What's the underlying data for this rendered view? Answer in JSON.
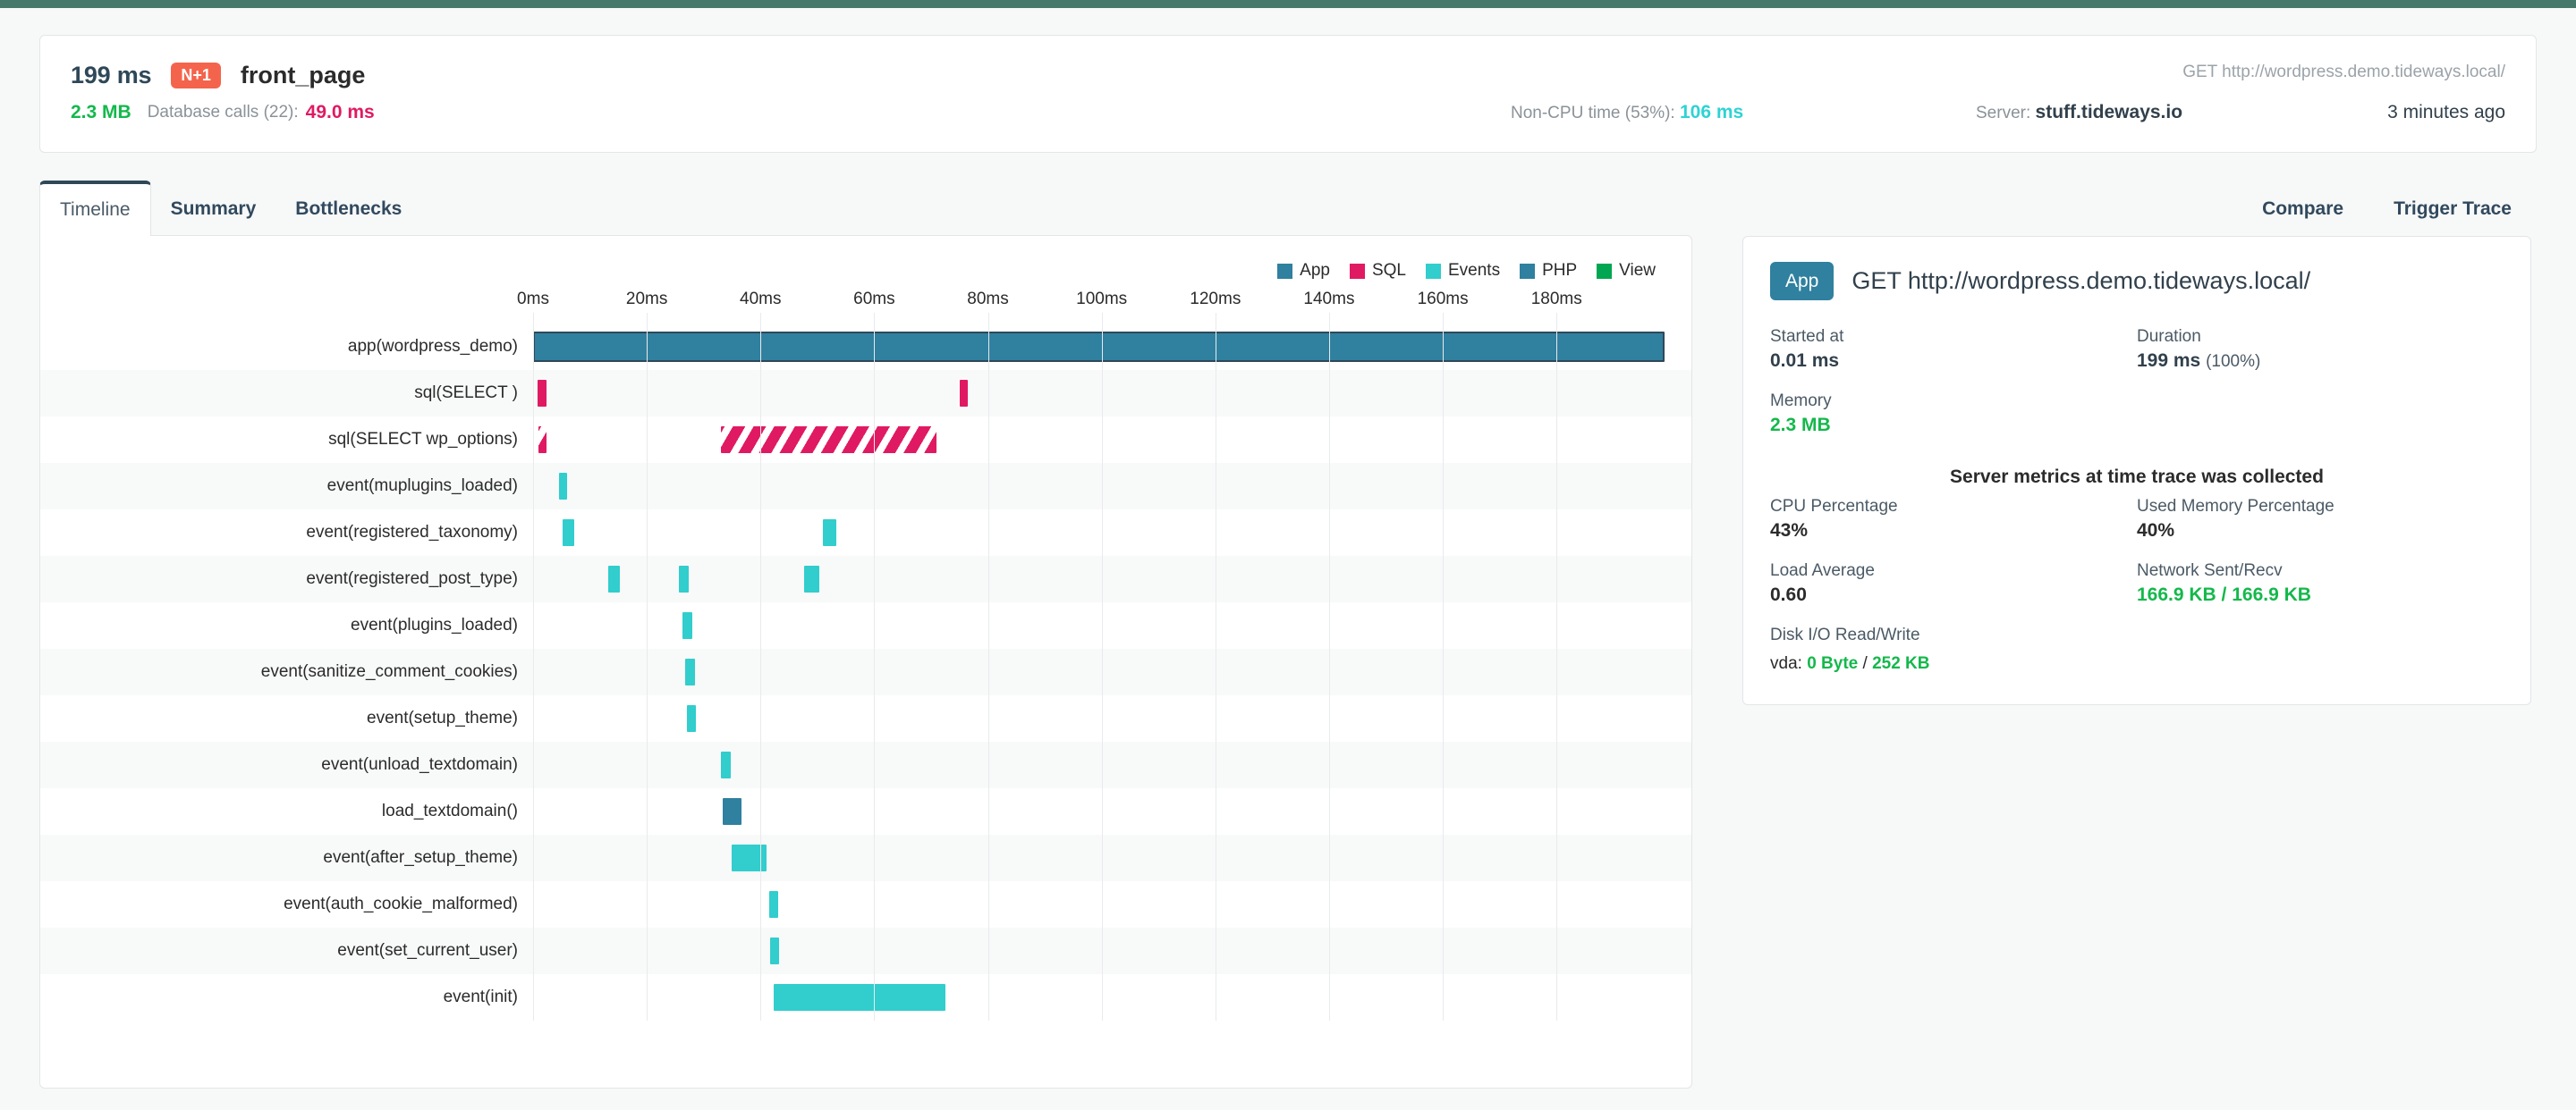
{
  "theme": {
    "topbar_color": "#46796b",
    "accent_blue": "#30809f",
    "accent_pink": "#e01a62",
    "accent_cyan": "#32cdcd",
    "accent_green": "#14b84b",
    "badge_color": "#f4644c"
  },
  "header": {
    "duration": "199 ms",
    "badge": "N+1",
    "transaction": "front_page",
    "url": "GET http://wordpress.demo.tideways.local/",
    "memory": "2.3 MB",
    "db_label": "Database calls (22):",
    "db_time": "49.0 ms",
    "noncpu_label": "Non-CPU time (53%):",
    "noncpu_value": "106 ms",
    "server_label": "Server:",
    "server_name": "stuff.tideways.io",
    "ago": "3 minutes ago"
  },
  "tabs": {
    "left": [
      {
        "label": "Timeline",
        "active": true
      },
      {
        "label": "Summary",
        "active": false
      },
      {
        "label": "Bottlenecks",
        "active": false
      }
    ],
    "right": [
      {
        "label": "Compare"
      },
      {
        "label": "Trigger Trace"
      }
    ]
  },
  "chart_data": {
    "type": "bar",
    "orientation": "horizontal-gantt",
    "title": "",
    "xlabel": "",
    "ylabel": "",
    "xlim": [
      0,
      199
    ],
    "grid": true,
    "legend_position": "top-right",
    "x_ticks": [
      "0ms",
      "20ms",
      "40ms",
      "60ms",
      "80ms",
      "100ms",
      "120ms",
      "140ms",
      "160ms",
      "180ms"
    ],
    "x_tick_values": [
      0,
      20,
      40,
      60,
      80,
      100,
      120,
      140,
      160,
      180
    ],
    "legend": [
      {
        "label": "App",
        "color": "#30809f"
      },
      {
        "label": "SQL",
        "color": "#e01a62"
      },
      {
        "label": "Events",
        "color": "#32cdcd"
      },
      {
        "label": "PHP",
        "color": "#30809f"
      },
      {
        "label": "View",
        "color": "#00a651"
      }
    ],
    "categories": [
      "app(wordpress_demo)",
      "sql(SELECT )",
      "sql(SELECT wp_options)",
      "event(muplugins_loaded)",
      "event(registered_taxonomy)",
      "event(registered_post_type)",
      "event(plugins_loaded)",
      "event(sanitize_comment_cookies)",
      "event(setup_theme)",
      "event(unload_textdomain)",
      "load_textdomain()",
      "event(after_setup_theme)",
      "event(auth_cookie_malformed)",
      "event(set_current_user)",
      "event(init)"
    ],
    "rows": [
      {
        "label": "app(wordpress_demo)",
        "type": "app",
        "spans": [
          {
            "start": 0.0,
            "end": 199.0
          }
        ]
      },
      {
        "label": "sql(SELECT )",
        "type": "sql",
        "spans": [
          {
            "start": 0.8,
            "end": 2.3
          },
          {
            "start": 75.0,
            "end": 76.5
          }
        ]
      },
      {
        "label": "sql(SELECT wp_options)",
        "type": "sql-n1",
        "spans": [
          {
            "start": 1.0,
            "end": 2.4
          },
          {
            "start": 33.0,
            "end": 71.0
          }
        ]
      },
      {
        "label": "event(muplugins_loaded)",
        "type": "events",
        "spans": [
          {
            "start": 4.6,
            "end": 6.0
          }
        ]
      },
      {
        "label": "event(registered_taxonomy)",
        "type": "events",
        "spans": [
          {
            "start": 5.2,
            "end": 7.2
          },
          {
            "start": 51.0,
            "end": 53.4
          }
        ]
      },
      {
        "label": "event(registered_post_type)",
        "type": "events",
        "spans": [
          {
            "start": 13.2,
            "end": 15.2
          },
          {
            "start": 25.6,
            "end": 27.4
          },
          {
            "start": 47.6,
            "end": 50.4
          }
        ]
      },
      {
        "label": "event(plugins_loaded)",
        "type": "events",
        "spans": [
          {
            "start": 26.3,
            "end": 28.0
          }
        ]
      },
      {
        "label": "event(sanitize_comment_cookies)",
        "type": "events",
        "spans": [
          {
            "start": 26.8,
            "end": 28.4
          }
        ]
      },
      {
        "label": "event(setup_theme)",
        "type": "events",
        "spans": [
          {
            "start": 27.0,
            "end": 28.6
          }
        ]
      },
      {
        "label": "event(unload_textdomain)",
        "type": "events",
        "spans": [
          {
            "start": 33.0,
            "end": 34.7
          }
        ]
      },
      {
        "label": "load_textdomain()",
        "type": "php",
        "spans": [
          {
            "start": 33.4,
            "end": 36.6
          }
        ]
      },
      {
        "label": "event(after_setup_theme)",
        "type": "events",
        "spans": [
          {
            "start": 35.0,
            "end": 41.0
          }
        ]
      },
      {
        "label": "event(auth_cookie_malformed)",
        "type": "events",
        "spans": [
          {
            "start": 41.6,
            "end": 43.1
          }
        ]
      },
      {
        "label": "event(set_current_user)",
        "type": "events",
        "spans": [
          {
            "start": 41.7,
            "end": 43.2
          }
        ]
      },
      {
        "label": "event(init)",
        "type": "events",
        "spans": [
          {
            "start": 42.3,
            "end": 72.5
          }
        ]
      }
    ]
  },
  "detail": {
    "chip": "App",
    "title": "GET http://wordpress.demo.tideways.local/",
    "started_at_label": "Started at",
    "started_at_value": "0.01 ms",
    "duration_label": "Duration",
    "duration_value": "199 ms",
    "duration_pct": "(100%)",
    "memory_label": "Memory",
    "memory_value": "2.3 MB",
    "metrics_title": "Server metrics at time trace was collected",
    "cpu_label": "CPU Percentage",
    "cpu_value": "43%",
    "usedmem_label": "Used Memory Percentage",
    "usedmem_value": "40%",
    "load_label": "Load Average",
    "load_value": "0.60",
    "net_label": "Network Sent/Recv",
    "net_value": "166.9 KB / 166.9 KB",
    "disk_label": "Disk I/O Read/Write",
    "disk_device": "vda:",
    "disk_read": "0 Byte",
    "disk_sep": "/",
    "disk_write": "252 KB"
  }
}
